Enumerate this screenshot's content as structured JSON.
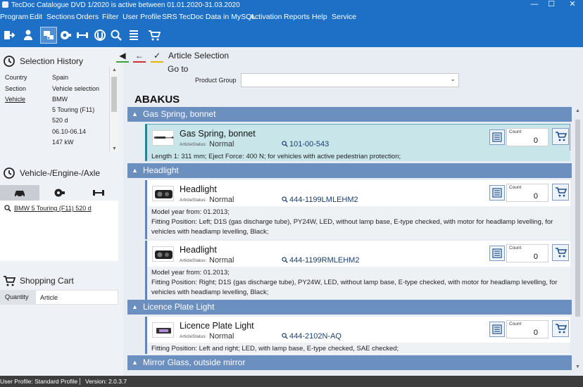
{
  "window": {
    "title": "TecDoc Catalogue DVD   1/2020 is active between 01.01.2020-31.03.2020",
    "minimize": "—",
    "maximize": "☐",
    "close": "✕"
  },
  "menu": [
    "Program",
    "Edit",
    "Sections",
    "Orders",
    "Filter",
    "User Profile",
    "SRS",
    "TecDoc Data in MySQL",
    "Activation",
    "Reports",
    "Help",
    "Service"
  ],
  "selection_history": {
    "title": "Selection History",
    "rows": [
      {
        "key": "Country",
        "value": "Spain"
      },
      {
        "key": "Section",
        "value": "Vehicle selection"
      },
      {
        "key": "Vehicle",
        "value": "BMW"
      },
      {
        "key": "",
        "value": "5 Touring (F11)"
      },
      {
        "key": "",
        "value": "520 d"
      },
      {
        "key": "",
        "value": "06.10-06.14"
      },
      {
        "key": "",
        "value": "147 kW"
      }
    ]
  },
  "vehicle_panel": {
    "title": "Vehicle-/Engine-/Axle",
    "selected_vehicle": "BMW 5 Touring (F11) 520 d"
  },
  "shopping_cart": {
    "title": "Shopping Cart",
    "col_quantity": "Quantity",
    "col_article": "Article"
  },
  "article_selection": {
    "title": "Article Selection",
    "goto": "Go to",
    "product_group_label": "Product Group",
    "product_group_value": "",
    "brand": "ABAKUS"
  },
  "labels": {
    "article_status": "ArticleStatus:",
    "count": "Count"
  },
  "groups": [
    {
      "name": "Gas Spring, bonnet",
      "articles": [
        {
          "name": "Gas Spring, bonnet",
          "status": "Normal",
          "article_no": "101-00-543",
          "count": "0",
          "info": [
            "Length 1: 311 mm; Eject Force: 400 N; for vehicles with active pedestrian protection;"
          ]
        }
      ]
    },
    {
      "name": "Headlight",
      "articles": [
        {
          "name": "Headlight",
          "status": "Normal",
          "article_no": "444-1199LMLEHM2",
          "count": "0",
          "info": [
            "Model year from: 01.2013;",
            "Fitting Position: Left; D1S (gas discharge tube), PY24W, LED, without lamp base, E-type checked, with motor for headlamp levelling, for vehicles with headlamp levelling, Black;"
          ]
        },
        {
          "name": "Headlight",
          "status": "Normal",
          "article_no": "444-1199RMLEHM2",
          "count": "0",
          "info": [
            "Model year from: 01.2013;",
            "Fitting Position: Right; D1S (gas discharge tube), PY24W, LED, without lamp base, E-type checked, with motor for headlamp levelling, for vehicles with headlamp levelling, Black;"
          ]
        }
      ]
    },
    {
      "name": "Licence Plate Light",
      "articles": [
        {
          "name": "Licence Plate Light",
          "status": "Normal",
          "article_no": "444-2102N-AQ",
          "count": "0",
          "info": [
            "Fitting Position: Left and right; LED, with lamp base, E-type checked, SAE checked;"
          ]
        }
      ]
    },
    {
      "name": "Mirror Glass, outside mirror",
      "articles": []
    }
  ],
  "statusbar": {
    "profile": "User Profile: Standard Profile",
    "version": "Version: 2.0.3.7"
  },
  "colors": {
    "accent": "#1d70c6",
    "group_header": "#6b8fbf",
    "selected_card": "#c8e6ea"
  }
}
